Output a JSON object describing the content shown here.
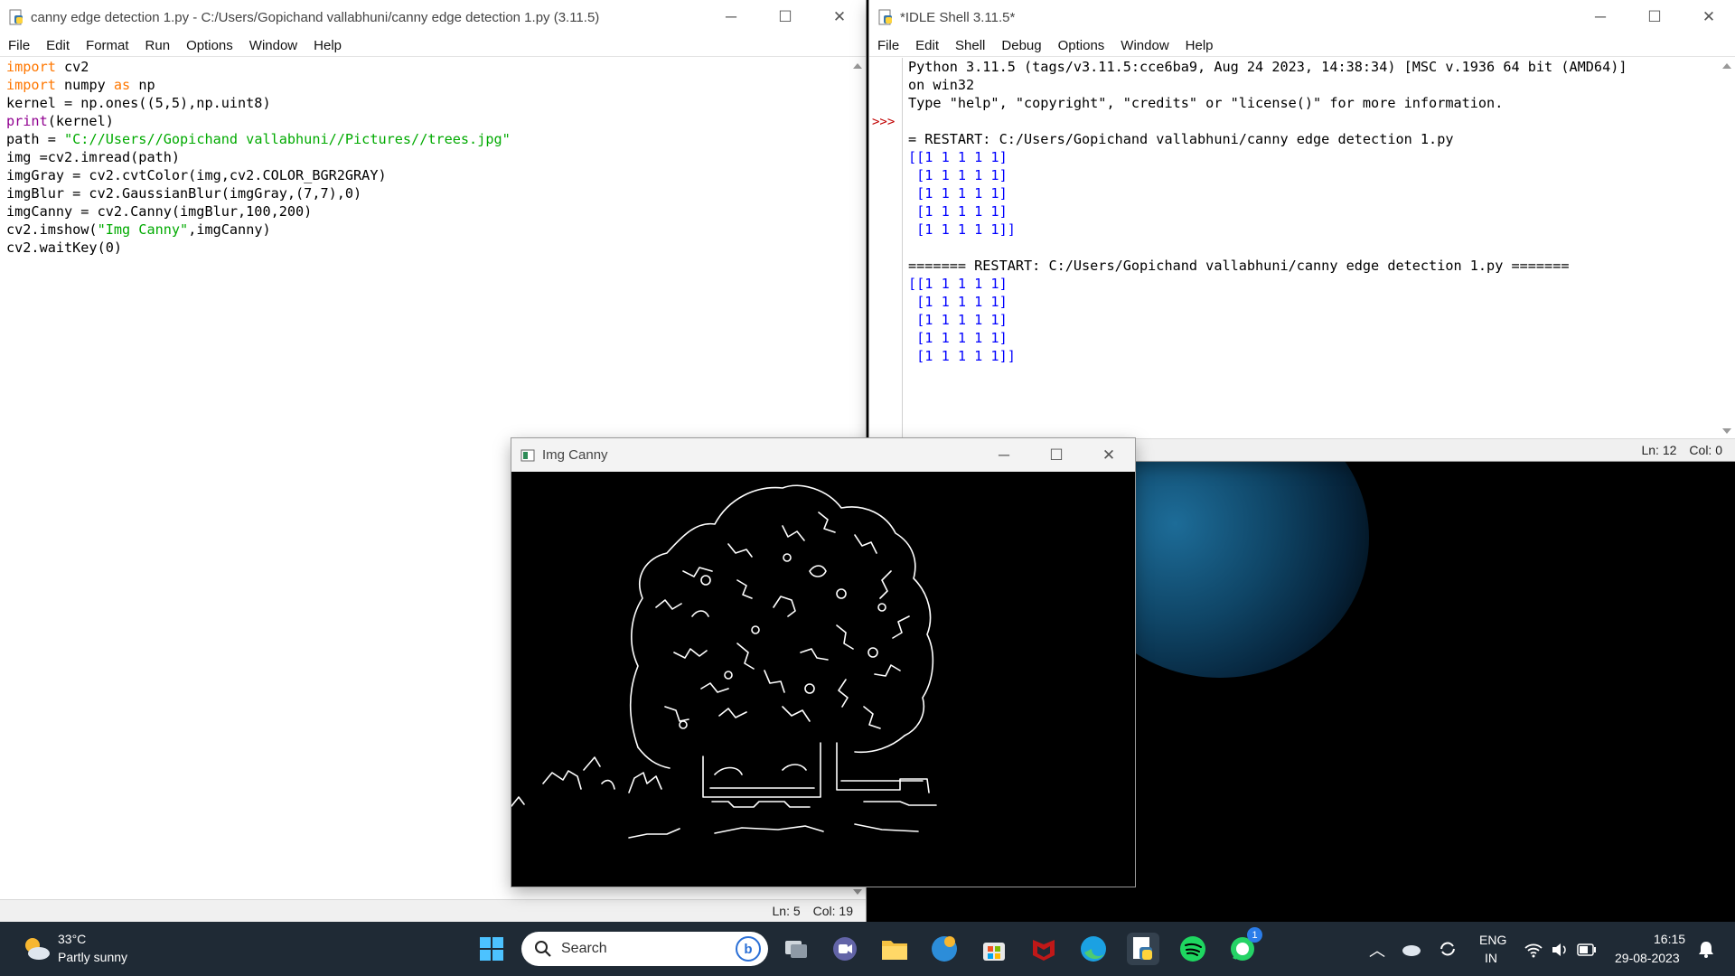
{
  "editor": {
    "title": "canny edge detection 1.py - C:/Users/Gopichand vallabhuni/canny edge detection 1.py (3.11.5)",
    "menu": [
      "File",
      "Edit",
      "Format",
      "Run",
      "Options",
      "Window",
      "Help"
    ],
    "code_lines": [
      [
        {
          "t": "import",
          "c": "kw"
        },
        {
          "t": " cv2"
        }
      ],
      [
        {
          "t": "import",
          "c": "kw"
        },
        {
          "t": " numpy "
        },
        {
          "t": "as",
          "c": "kw"
        },
        {
          "t": " np"
        }
      ],
      [
        {
          "t": "kernel = np.ones((5,5),np.uint8)"
        }
      ],
      [
        {
          "t": "print",
          "c": "bi"
        },
        {
          "t": "(kernel)"
        }
      ],
      [
        {
          "t": "path = "
        },
        {
          "t": "\"C://Users//Gopichand vallabhuni//Pictures//trees.jpg\"",
          "c": "st"
        }
      ],
      [
        {
          "t": "img =cv2.imread(path)"
        }
      ],
      [
        {
          "t": "imgGray = cv2.cvtColor(img,cv2.COLOR_BGR2GRAY)"
        }
      ],
      [
        {
          "t": "imgBlur = cv2.GaussianBlur(imgGray,(7,7),0)"
        }
      ],
      [
        {
          "t": "imgCanny = cv2.Canny(imgBlur,100,200)"
        }
      ],
      [
        {
          "t": "cv2.imshow("
        },
        {
          "t": "\"Img Canny\"",
          "c": "st"
        },
        {
          "t": ",imgCanny)"
        }
      ],
      [
        {
          "t": "cv2.waitKey(0)"
        }
      ]
    ],
    "status_ln": "Ln: 5",
    "status_col": "Col: 19"
  },
  "shell": {
    "title": "*IDLE Shell 3.11.5*",
    "menu": [
      "File",
      "Edit",
      "Shell",
      "Debug",
      "Options",
      "Window",
      "Help"
    ],
    "prompt": ">>>",
    "lines": [
      {
        "t": "Python 3.11.5 (tags/v3.11.5:cce6ba9, Aug 24 2023, 14:38:34) [MSC v.1936 64 bit (AMD64)]",
        "c": ""
      },
      {
        "t": "on win32",
        "c": ""
      },
      {
        "t": "Type \"help\", \"copyright\", \"credits\" or \"license()\" for more information.",
        "c": ""
      },
      {
        "t": "",
        "c": ""
      },
      {
        "t": "= RESTART: C:/Users/Gopichand vallabhuni/canny edge detection 1.py",
        "c": ""
      },
      {
        "t": "[[1 1 1 1 1]",
        "c": "out"
      },
      {
        "t": " [1 1 1 1 1]",
        "c": "out"
      },
      {
        "t": " [1 1 1 1 1]",
        "c": "out"
      },
      {
        "t": " [1 1 1 1 1]",
        "c": "out"
      },
      {
        "t": " [1 1 1 1 1]]",
        "c": "out"
      },
      {
        "t": "",
        "c": ""
      },
      {
        "t": "======= RESTART: C:/Users/Gopichand vallabhuni/canny edge detection 1.py =======",
        "c": ""
      },
      {
        "t": "[[1 1 1 1 1]",
        "c": "out"
      },
      {
        "t": " [1 1 1 1 1]",
        "c": "out"
      },
      {
        "t": " [1 1 1 1 1]",
        "c": "out"
      },
      {
        "t": " [1 1 1 1 1]",
        "c": "out"
      },
      {
        "t": " [1 1 1 1 1]]",
        "c": "out"
      }
    ],
    "status_ln": "Ln: 12",
    "status_col": "Col: 0"
  },
  "canny_window": {
    "title": "Img Canny"
  },
  "taskbar": {
    "weather_temp": "33°C",
    "weather_desc": "Partly sunny",
    "search_placeholder": "Search",
    "lang_top": "ENG",
    "lang_bottom": "IN",
    "time": "16:15",
    "date": "29-08-2023",
    "whatsapp_badge": "1",
    "icons": [
      "windows-start-icon",
      "search-icon",
      "task-view-icon",
      "teams-meet-icon",
      "file-explorer-icon",
      "weather-app-icon",
      "microsoft-store-icon",
      "mcafee-icon",
      "edge-icon",
      "idle-python-icon",
      "spotify-icon",
      "whatsapp-icon"
    ]
  },
  "colors": {
    "keyword": "#ff7700",
    "builtin": "#900090",
    "string": "#00aa00",
    "output": "#0000ff",
    "prompt": "#c00000",
    "taskbar": "#1f2a35"
  }
}
